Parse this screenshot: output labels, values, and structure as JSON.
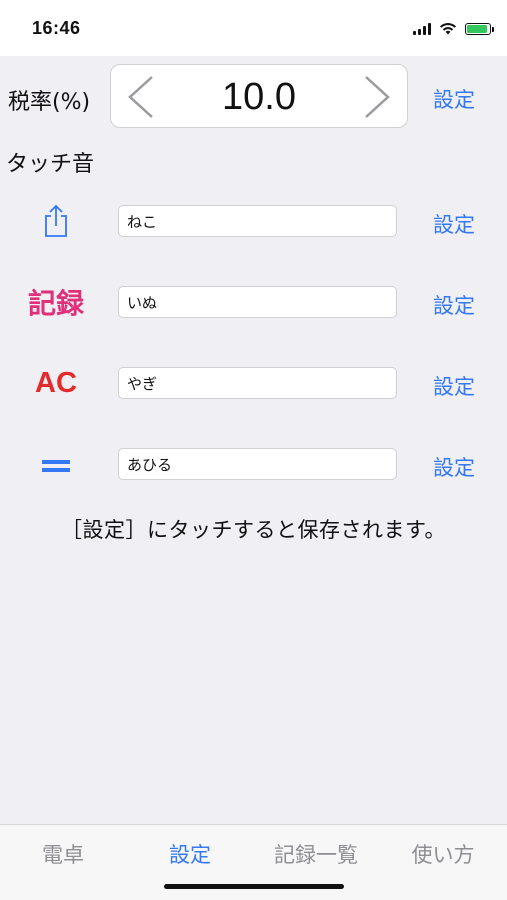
{
  "status_bar": {
    "time": "16:46",
    "icons": [
      "signal-icon",
      "wifi-icon",
      "battery-charging-icon"
    ],
    "battery_color": "#34c759"
  },
  "tax": {
    "label": "税率(%)",
    "value": "10.0",
    "set_label": "設定"
  },
  "touch_sound": {
    "title": "タッチ音",
    "rows": [
      {
        "icon": "share-icon",
        "icon_text": "",
        "value": "ねこ",
        "set_label": "設定"
      },
      {
        "icon": "record-icon",
        "icon_text": "記録",
        "value": "いぬ",
        "set_label": "設定"
      },
      {
        "icon": "ac-icon",
        "icon_text": "AC",
        "value": "やぎ",
        "set_label": "設定"
      },
      {
        "icon": "equals-icon",
        "icon_text": "",
        "value": "あひる",
        "set_label": "設定"
      }
    ]
  },
  "note": "［設定］にタッチすると保存されます。",
  "tabs": [
    {
      "label": "電卓",
      "active": false
    },
    {
      "label": "設定",
      "active": true
    },
    {
      "label": "記録一覧",
      "active": false
    },
    {
      "label": "使い方",
      "active": false
    }
  ],
  "colors": {
    "accent": "#3478f6",
    "record": "#e0307a",
    "ac": "#e32b2b",
    "inactive_tab": "#8e8e93"
  }
}
